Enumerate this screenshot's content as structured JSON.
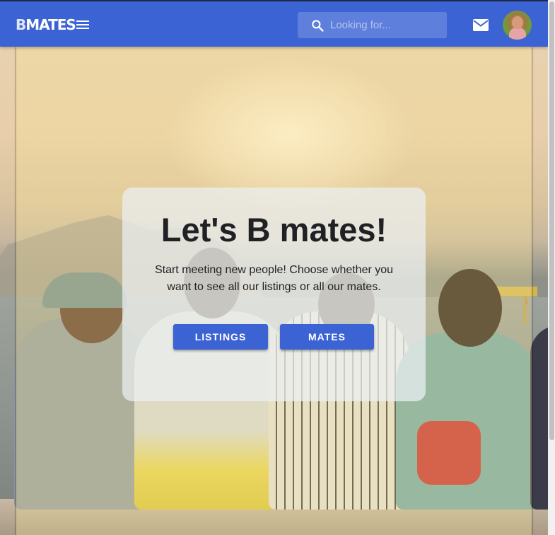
{
  "header": {
    "logo_text": "MATES",
    "logo_prefix": "B",
    "search_placeholder": "Looking for...",
    "icons": [
      "menu-icon",
      "search-icon",
      "mail-icon",
      "avatar"
    ]
  },
  "hero": {
    "title": "Let's B mates!",
    "subtitle": "Start meeting new people! Choose whether you want to see all our listings or all our mates.",
    "buttons": {
      "listings": "LISTINGS",
      "mates": "MATES"
    }
  },
  "colors": {
    "primary": "#3b63d3",
    "card": "#ecf0f4",
    "text": "#202124"
  }
}
